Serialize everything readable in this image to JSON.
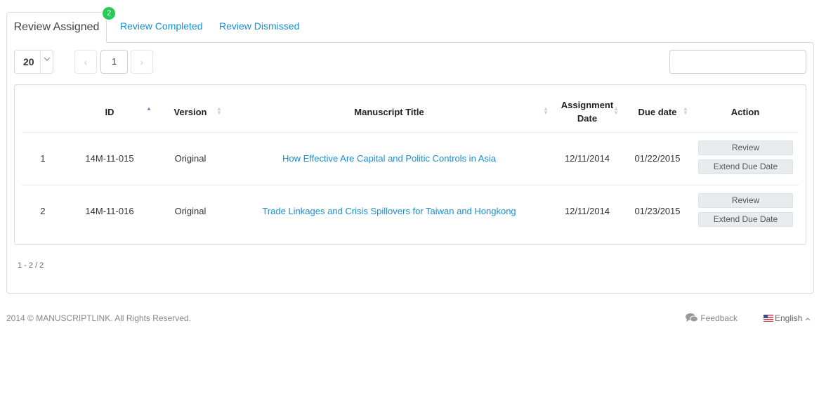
{
  "tabs": {
    "active": "Review Assigned",
    "badge": "2",
    "completed": "Review Completed",
    "dismissed": "Review Dismissed"
  },
  "toolbar": {
    "per_page": "20",
    "current_page": "1",
    "prev_symbol": "‹",
    "next_symbol": "›",
    "search_placeholder": ""
  },
  "table": {
    "headers": {
      "id": "ID",
      "version": "Version",
      "title": "Manuscript Title",
      "assignment_line1": "Assignment",
      "assignment_line2": "Date",
      "due": "Due date",
      "action": "Action"
    },
    "rows": [
      {
        "num": "1",
        "id": "14M-11-015",
        "version": "Original",
        "title": "How Effective Are Capital and Politic Controls in Asia",
        "assigned": "12/11/2014",
        "due": "01/22/2015",
        "review": "Review",
        "extend": "Extend Due Date"
      },
      {
        "num": "2",
        "id": "14M-11-016",
        "version": "Original",
        "title": "Trade Linkages and Crisis Spillovers for Taiwan and Hongkong",
        "assigned": "12/11/2014",
        "due": "01/23/2015",
        "review": "Review",
        "extend": "Extend Due Date"
      }
    ]
  },
  "count": "1 - 2 / 2",
  "footer": {
    "copyright": "2014 © MANUSCRIPTLINK. All Rights Reserved.",
    "feedback": "Feedback",
    "language": "English"
  },
  "colors": {
    "accent": "#1a8fd0",
    "badge": "#22cc55",
    "sort_active": "#7f7fcc"
  }
}
